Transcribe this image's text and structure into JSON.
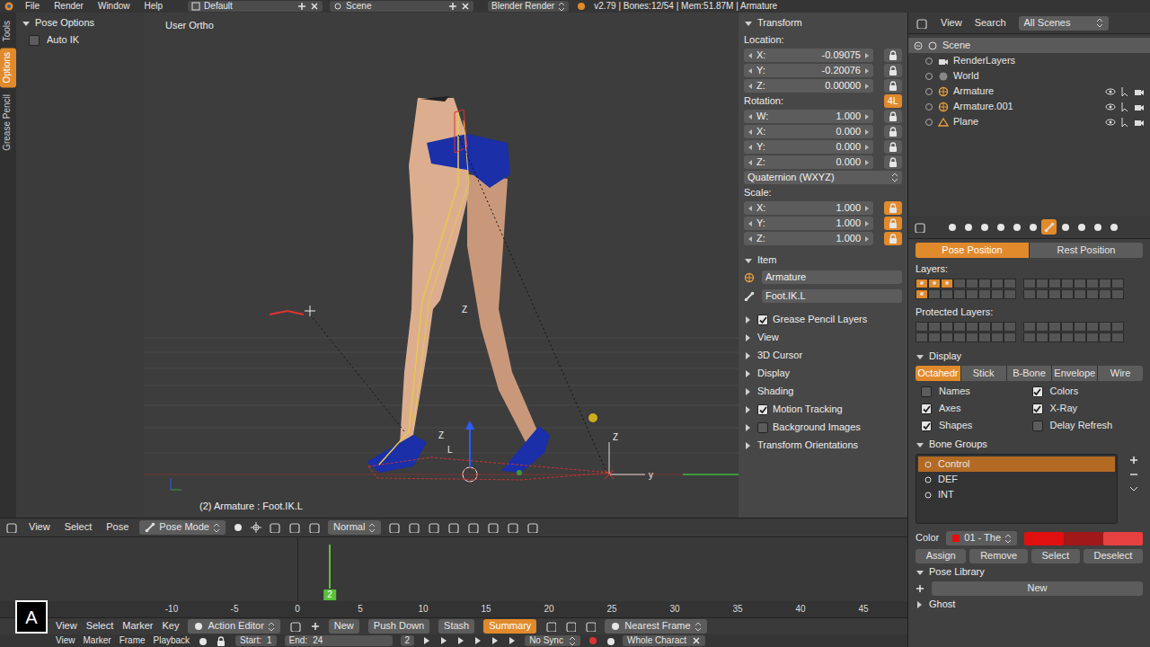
{
  "info_bar": {
    "menus": [
      "File",
      "Render",
      "Window",
      "Help"
    ],
    "layout": "Default",
    "scene": "Scene",
    "engine": "Blender Render",
    "stats": "v2.79 | Bones:12/54 | Mem:51.87M | Armature"
  },
  "tool_shelf": {
    "tabs": [
      {
        "label": "Tools",
        "selected": false
      },
      {
        "label": "Options",
        "selected": true
      },
      {
        "label": "Grease Pencil",
        "selected": false
      }
    ],
    "panel_title": "Pose Options",
    "options": [
      {
        "label": "Auto IK",
        "checked": false
      }
    ]
  },
  "viewport": {
    "view_name": "User Ortho",
    "status": "(2) Armature : Foot.IK.L",
    "gizmo_labels": [
      "Z",
      "Z",
      "L",
      "Z",
      "y"
    ]
  },
  "viewport_header": {
    "menus": [
      "View",
      "Select",
      "Pose"
    ],
    "mode": "Pose Mode",
    "orientation": "Normal"
  },
  "n_panel": {
    "transform": {
      "title": "Transform",
      "location_label": "Location:",
      "location": [
        {
          "axis": "X:",
          "value": "-0.09075",
          "locked": false
        },
        {
          "axis": "Y:",
          "value": "-0.20076",
          "locked": false
        },
        {
          "axis": "Z:",
          "value": "0.00000",
          "locked": false
        }
      ],
      "rotation_label": "Rotation:",
      "rotation_lock": {
        "label": "4L",
        "on": true
      },
      "rotation": [
        {
          "axis": "W:",
          "value": "1.000",
          "locked": false
        },
        {
          "axis": "X:",
          "value": "0.000",
          "locked": false
        },
        {
          "axis": "Y:",
          "value": "0.000",
          "locked": false
        },
        {
          "axis": "Z:",
          "value": "0.000",
          "locked": false
        }
      ],
      "rotation_mode": "Quaternion (WXYZ)",
      "scale_label": "Scale:",
      "scale": [
        {
          "axis": "X:",
          "value": "1.000",
          "locked": true
        },
        {
          "axis": "Y:",
          "value": "1.000",
          "locked": true
        },
        {
          "axis": "Z:",
          "value": "1.000",
          "locked": true
        }
      ]
    },
    "item": {
      "title": "Item",
      "object": "Armature",
      "bone": "Foot.IK.L"
    },
    "sections": [
      {
        "label": "Grease Pencil Layers",
        "kind": "checkbox",
        "checked": true
      },
      {
        "label": "View",
        "kind": "plain"
      },
      {
        "label": "3D Cursor",
        "kind": "plain"
      },
      {
        "label": "Display",
        "kind": "plain"
      },
      {
        "label": "Shading",
        "kind": "plain"
      },
      {
        "label": "Motion Tracking",
        "kind": "checkbox",
        "checked": true
      },
      {
        "label": "Background Images",
        "kind": "checkbox",
        "checked": false
      },
      {
        "label": "Transform Orientations",
        "kind": "plain"
      }
    ]
  },
  "outliner": {
    "menus": [
      "View",
      "Search"
    ],
    "filter": "All Scenes",
    "tree": {
      "label": "Scene",
      "selected": true,
      "expanded": true,
      "children": [
        {
          "label": "RenderLayers",
          "selected": false
        },
        {
          "label": "World",
          "selected": false
        },
        {
          "label": "Armature",
          "selected": false
        },
        {
          "label": "Armature.001",
          "selected": false
        },
        {
          "label": "Plane",
          "selected": false
        }
      ]
    }
  },
  "properties": {
    "context_tabs": [
      {
        "selected": false
      },
      {
        "selected": false
      },
      {
        "selected": false
      },
      {
        "selected": false
      },
      {
        "selected": false
      },
      {
        "selected": false
      },
      {
        "selected": true
      },
      {
        "selected": false
      },
      {
        "selected": false
      },
      {
        "selected": false
      },
      {
        "selected": false
      }
    ],
    "pose_toggle": [
      {
        "label": "Pose Position",
        "selected": true
      },
      {
        "label": "Rest Position",
        "selected": false
      }
    ],
    "layers_label": "Layers:",
    "layers_on": [
      true,
      true,
      true,
      false,
      false,
      false,
      false,
      false,
      false,
      false,
      false,
      false,
      false,
      false,
      false,
      false,
      true,
      false,
      false,
      false,
      false,
      false,
      false,
      false,
      false,
      false,
      false,
      false,
      false,
      false,
      false,
      false
    ],
    "layers_used": [
      true,
      true,
      true,
      false,
      false,
      false,
      false,
      false,
      false,
      false,
      false,
      false,
      false,
      false,
      false,
      false,
      true,
      false,
      false,
      false,
      false,
      false,
      false,
      false,
      false,
      false,
      false,
      false,
      false,
      false,
      false,
      false
    ],
    "protected_label": "Protected Layers:",
    "protected": [
      false,
      false,
      false,
      false,
      false,
      false,
      false,
      false,
      false,
      false,
      false,
      false,
      false,
      false,
      false,
      false,
      false,
      false,
      false,
      false,
      false,
      false,
      false,
      false,
      false,
      false,
      false,
      false,
      false,
      false,
      false,
      false
    ],
    "display": {
      "title": "Display",
      "draw_types": [
        {
          "label": "Octahedr",
          "selected": true
        },
        {
          "label": "Stick",
          "selected": false
        },
        {
          "label": "B-Bone",
          "selected": false
        },
        {
          "label": "Envelope",
          "selected": false
        },
        {
          "label": "Wire",
          "selected": false
        }
      ],
      "options": [
        {
          "label": "Names",
          "checked": false
        },
        {
          "label": "Colors",
          "checked": true
        },
        {
          "label": "Axes",
          "checked": true
        },
        {
          "label": "X-Ray",
          "checked": true
        },
        {
          "label": "Shapes",
          "checked": true
        },
        {
          "label": "Delay Refresh",
          "checked": false
        }
      ]
    },
    "bone_groups": {
      "title": "Bone Groups",
      "items": [
        {
          "label": "Control",
          "selected": true
        },
        {
          "label": "DEF",
          "selected": false
        },
        {
          "label": "INT",
          "selected": false
        }
      ],
      "color_label": "Color",
      "color_set": "01 - The",
      "swatches": [
        {
          "color": "#e01010"
        },
        {
          "color": "#a01818"
        },
        {
          "color": "#e64040"
        }
      ],
      "buttons": [
        "Assign",
        "Remove",
        "Select",
        "Deselect"
      ]
    },
    "pose_library": {
      "title": "Pose Library",
      "new": "New"
    },
    "ghost": {
      "title": "Ghost"
    }
  },
  "timeline": {
    "ticks": [
      "-10",
      "-5",
      "0",
      "5",
      "10",
      "15",
      "20",
      "25",
      "30",
      "35",
      "40",
      "45"
    ],
    "current_frame": "2"
  },
  "timeline_header": {
    "menus": [
      "View",
      "Select",
      "Marker",
      "Key"
    ],
    "mode": "Action Editor",
    "new": "New",
    "push_down": "Push Down",
    "stash": "Stash",
    "summary": {
      "label": "Summary",
      "on": true
    },
    "snap": "Nearest Frame"
  },
  "playback_bar": {
    "menus": [
      "View",
      "Marker",
      "Frame",
      "Playback"
    ],
    "start_label": "Start:",
    "start": "1",
    "end_label": "End:",
    "end": "24",
    "frame": "2",
    "sync": "No Sync",
    "keying_set": "Whole Charact"
  },
  "key_overlay": {
    "key": "A"
  }
}
